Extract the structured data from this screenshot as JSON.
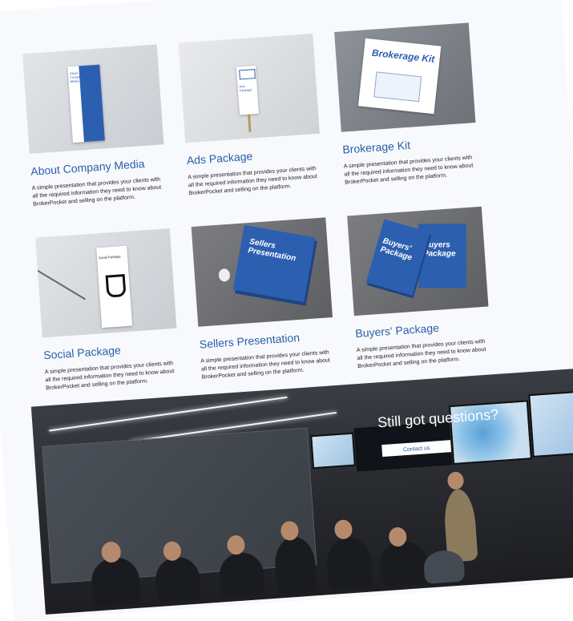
{
  "cards": [
    {
      "title": "About Company Media",
      "desc": "A simple presentation that provides your clients with all the required information they need to know about BrokerPocket and selling on the platform."
    },
    {
      "title": "Ads Package",
      "desc": "A simple presentation that provides your clients with all the required information they need to know about BrokerPocket and selling on the platform."
    },
    {
      "title": "Brokerage Kit",
      "desc": "A simple presentation that provides your clients with all the required information they need to know about BrokerPocket and selling on the platform."
    },
    {
      "title": "Social Package",
      "desc": "A simple presentation that provides your clients with all the required information they need to know about BrokerPocket and selling on the platform."
    },
    {
      "title": "Sellers Presentation",
      "desc": "A simple presentation that provides your clients with all the required information they need to know about BrokerPocket and selling on the platform."
    },
    {
      "title": "Buyers' Package",
      "desc": "A simple presentation that provides your clients with all the required information they need to know about BrokerPocket and selling on the platform."
    }
  ],
  "mockups": {
    "about_text": "About Company Media",
    "ads_text": "Ads Package",
    "kit_text": "Brokerage Kit",
    "social_text": "Social Package",
    "sellers_text": "Sellers Presentation",
    "buyers_text_1": "Buyers' Package",
    "buyers_text_2": "Buyers Package",
    "brand_small": "BrokerPocket"
  },
  "banner": {
    "heading": "Still got questions?",
    "button_label": "Contact us"
  },
  "colors": {
    "accent": "#2a5ea8",
    "button_bg": "#ffffff",
    "button_text": "#1c4f9c"
  }
}
